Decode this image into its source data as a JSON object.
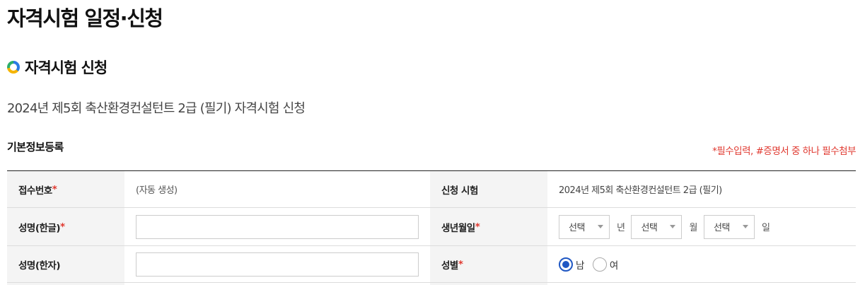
{
  "page_title": "자격시험 일정·신청",
  "section_title": "자격시험 신청",
  "exam_subtitle": "2024년 제5회 축산환경컨설턴트 2급 (필기) 자격시험 신청",
  "form": {
    "heading": "기본정보등록",
    "required_note": "*필수입력, #증명서 중 하나 필수첨부",
    "required_mark": "*",
    "rows": [
      {
        "label": "접수번호",
        "value": "(자동 생성)",
        "label2": "신청 시험",
        "value2": "2024년 제5회 축산환경컨설턴트 2급 (필기)"
      },
      {
        "label": "성명(한글)",
        "input_value": "",
        "label2": "생년월일"
      },
      {
        "label": "성명(한자)",
        "input_value": "",
        "label2": "성별"
      }
    ],
    "birth": {
      "year_select": "선택",
      "year_unit": "년",
      "month_select": "선택",
      "month_unit": "월",
      "day_select": "선택",
      "day_unit": "일"
    },
    "gender": {
      "male": "남",
      "female": "여",
      "selected": "남"
    }
  },
  "colors": {
    "required_red": "#e0382f",
    "radio_blue": "#1f57c3",
    "header_bg": "#f4f4f4"
  }
}
